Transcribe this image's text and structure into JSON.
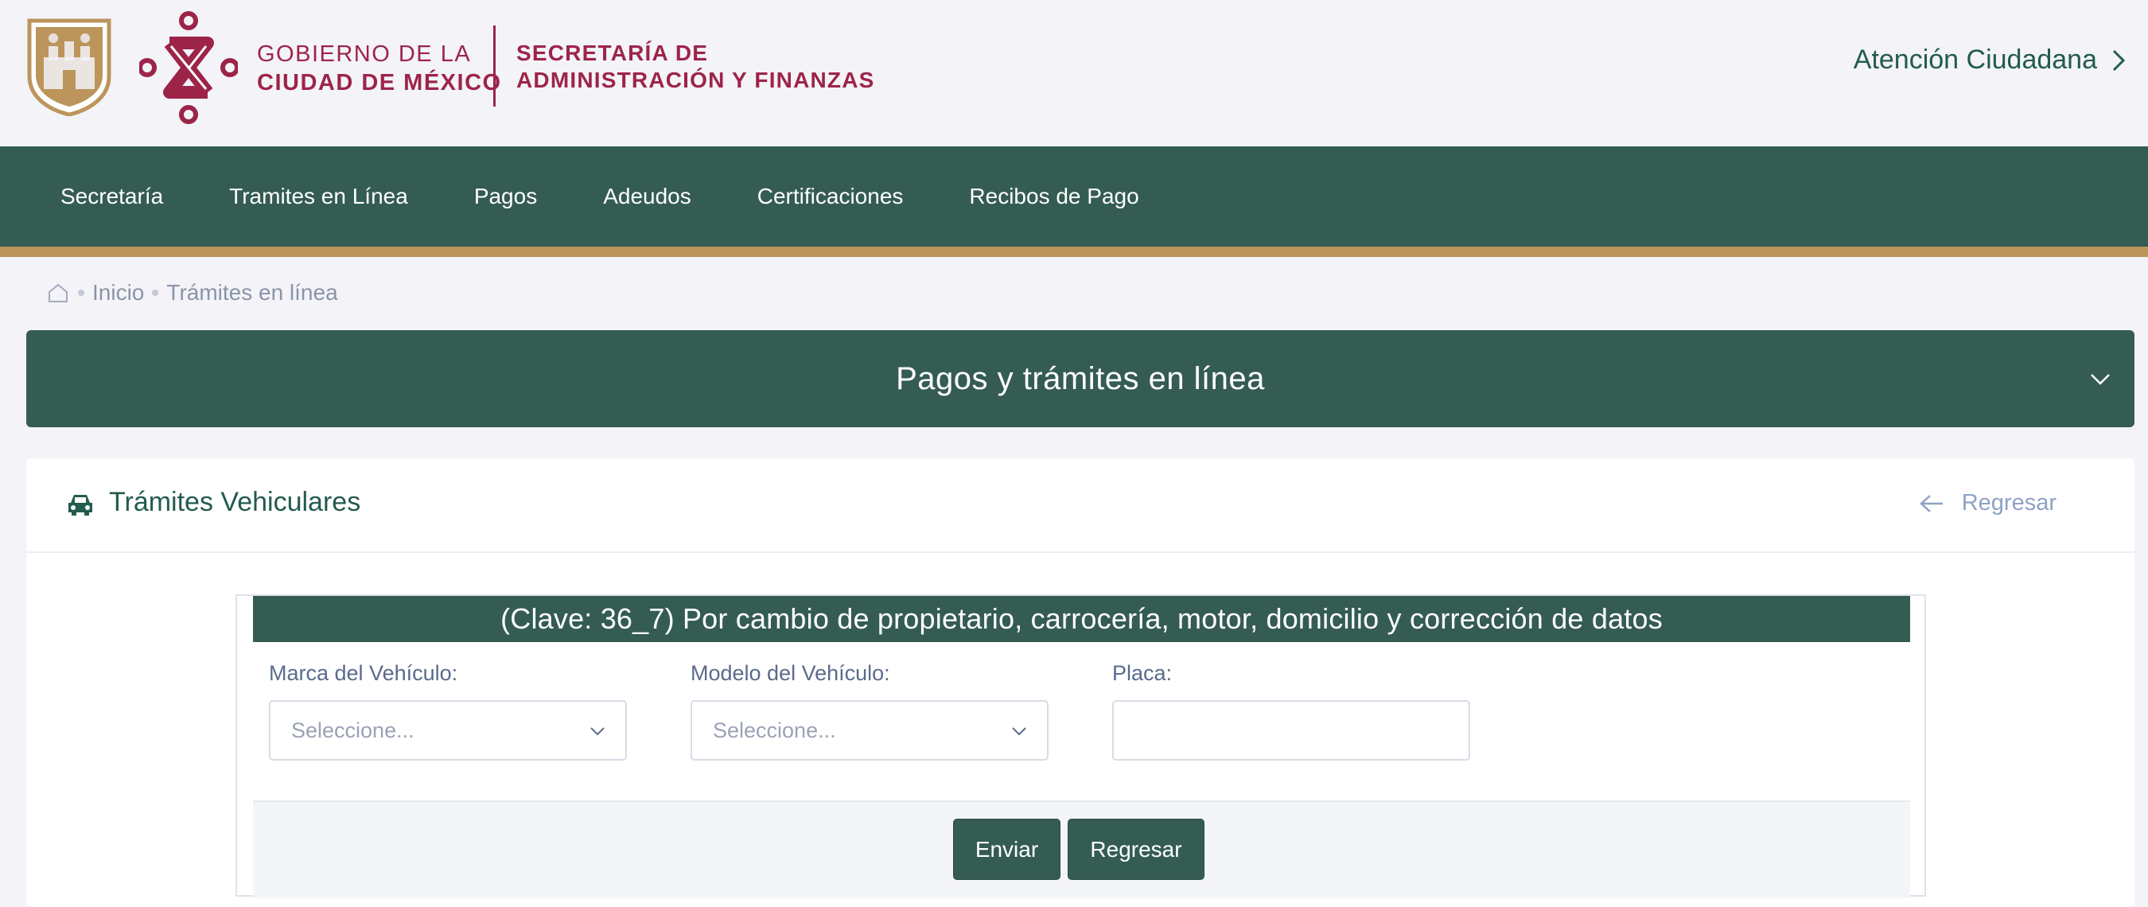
{
  "header": {
    "gov_line1": "GOBIERNO DE LA",
    "gov_line2": "CIUDAD DE MÉXICO",
    "sec_line1": "SECRETARÍA DE",
    "sec_line2": "ADMINISTRACIÓN Y FINANZAS",
    "atencion_label": "Atención Ciudadana"
  },
  "nav": {
    "items": [
      {
        "label": "Secretaría"
      },
      {
        "label": "Tramites en Línea"
      },
      {
        "label": "Pagos"
      },
      {
        "label": "Adeudos"
      },
      {
        "label": "Certificaciones"
      },
      {
        "label": "Recibos de Pago"
      }
    ]
  },
  "breadcrumb": {
    "items": [
      {
        "label": "Inicio"
      },
      {
        "label": "Trámites en línea"
      }
    ]
  },
  "banner": {
    "title": "Pagos y trámites en línea"
  },
  "card": {
    "title": "Trámites Vehiculares",
    "back_label": "Regresar"
  },
  "form": {
    "title": "(Clave: 36_7) Por cambio de propietario, carrocería, motor, domicilio y corrección de datos",
    "marca_label": "Marca del Vehículo:",
    "marca_value": "Seleccione...",
    "modelo_label": "Modelo del Vehículo:",
    "modelo_value": "Seleccione...",
    "placa_label": "Placa:",
    "placa_value": "",
    "submit_label": "Enviar",
    "back_label": "Regresar"
  },
  "colors": {
    "brand_green": "#345c52",
    "brand_gold": "#bc955c",
    "brand_wine": "#9d2449"
  }
}
